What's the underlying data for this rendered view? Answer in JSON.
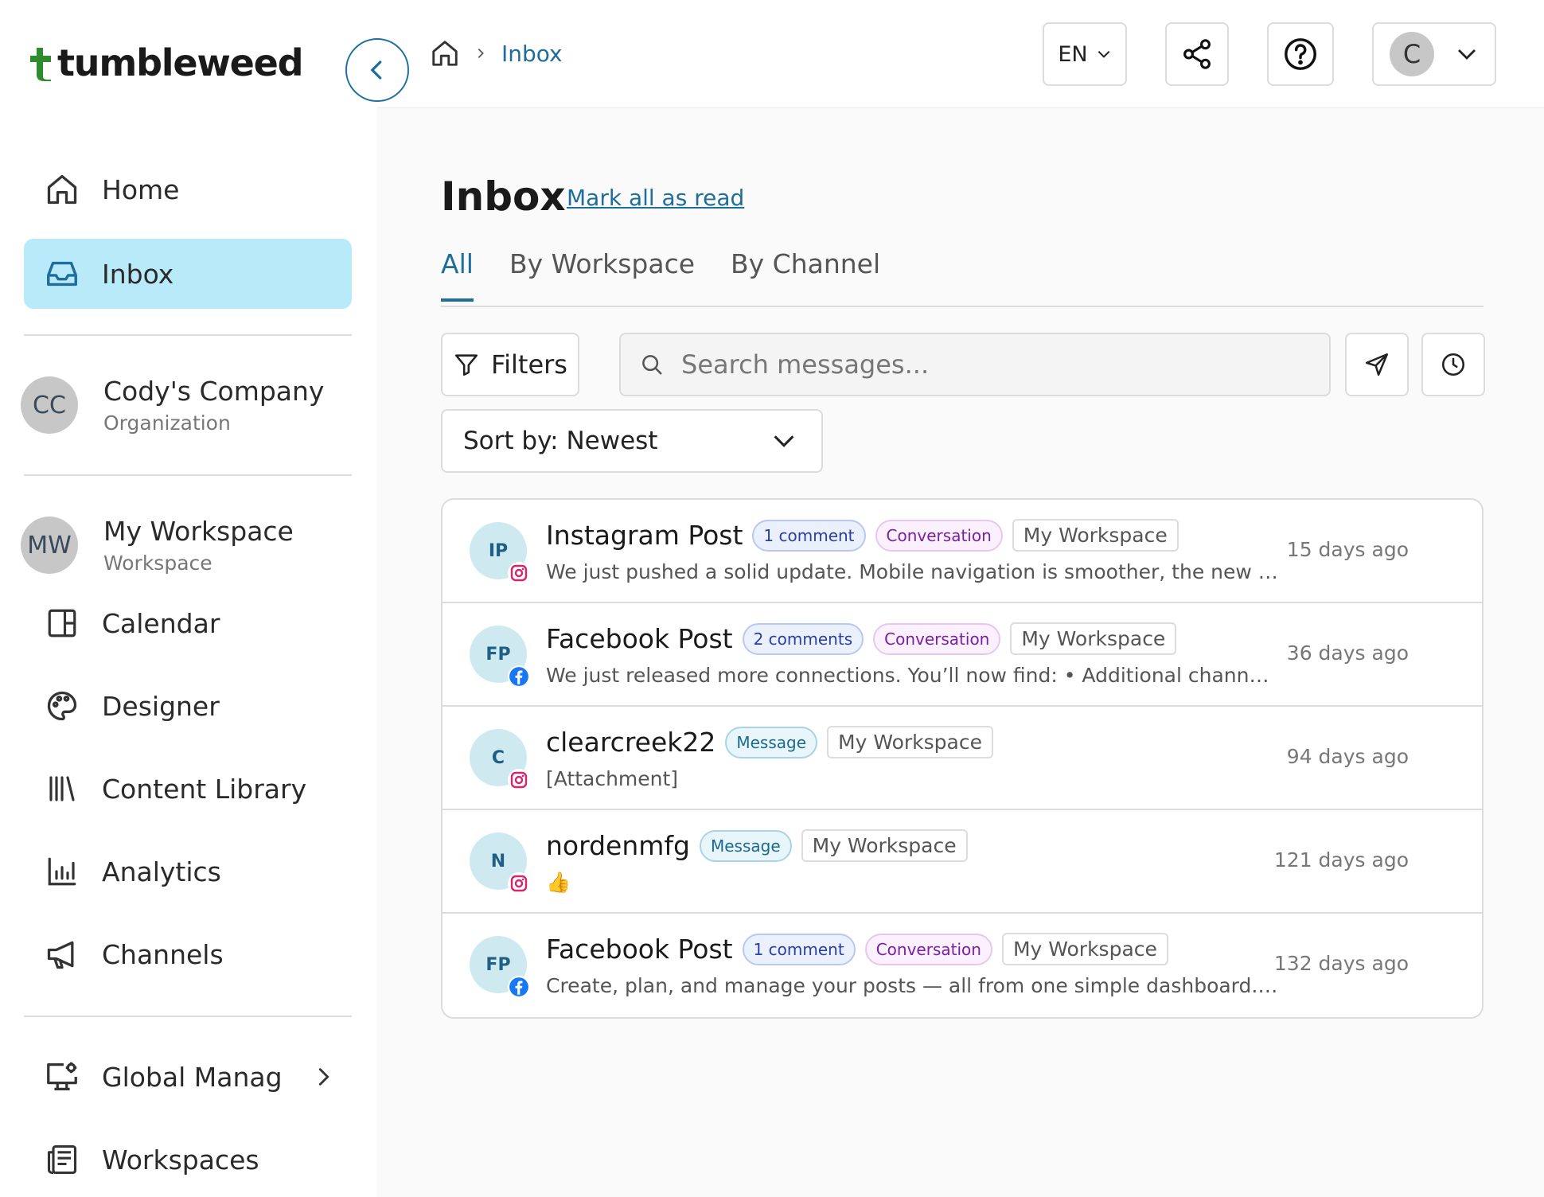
{
  "app": {
    "brand": "tumbleweed",
    "brand_color": "#2e8b2e",
    "accent": "#1f6e9a"
  },
  "sidebar": {
    "primary": [
      {
        "label": "Home",
        "icon": "home-icon"
      },
      {
        "label": "Inbox",
        "icon": "inbox-icon",
        "active": true
      }
    ],
    "organization": {
      "initials": "CC",
      "name": "Cody's Company",
      "type": "Organization"
    },
    "workspace": {
      "initials": "MW",
      "name": "My Workspace",
      "type": "Workspace"
    },
    "workspace_items": [
      {
        "label": "Calendar",
        "icon": "calendar-icon"
      },
      {
        "label": "Designer",
        "icon": "palette-icon"
      },
      {
        "label": "Content Library",
        "icon": "library-icon"
      },
      {
        "label": "Analytics",
        "icon": "analytics-icon"
      },
      {
        "label": "Channels",
        "icon": "megaphone-icon"
      }
    ],
    "bottom_items": [
      {
        "label": "Global Manag",
        "icon": "monitor-gear-icon",
        "has_chevron": true
      },
      {
        "label": "Workspaces",
        "icon": "workspaces-icon"
      }
    ]
  },
  "topbar": {
    "breadcrumb": {
      "current": "Inbox"
    },
    "language": "EN",
    "user_initial": "C"
  },
  "main": {
    "title": "Inbox",
    "mark_all_read": "Mark all as read",
    "tabs": [
      {
        "label": "All",
        "active": true
      },
      {
        "label": "By Workspace"
      },
      {
        "label": "By Channel"
      }
    ],
    "filters_label": "Filters",
    "search_placeholder": "Search messages...",
    "sort_label": "Sort by: Newest",
    "messages": [
      {
        "initials": "IP",
        "platform": "instagram",
        "title": "Instagram Post",
        "count": "1 comment",
        "type": "Conversation",
        "workspace": "My Workspace",
        "preview": "We just pushed a solid update. Mobile navigation is smoother, the new Wor...",
        "time": "15 days ago"
      },
      {
        "initials": "FP",
        "platform": "facebook",
        "title": "Facebook Post",
        "count": "2 comments",
        "type": "Conversation",
        "workspace": "My Workspace",
        "preview": "We just released more connections. You’ll now find: • Additional channel su...",
        "time": "36 days ago"
      },
      {
        "initials": "C",
        "platform": "instagram",
        "title": "clearcreek22",
        "type": "Message",
        "workspace": "My Workspace",
        "preview": "[Attachment]",
        "time": "94 days ago"
      },
      {
        "initials": "N",
        "platform": "instagram",
        "title": "nordenmfg",
        "type": "Message",
        "workspace": "My Workspace",
        "preview": "👍",
        "time": "121 days ago"
      },
      {
        "initials": "FP",
        "platform": "facebook",
        "title": "Facebook Post",
        "count": "1 comment",
        "type": "Conversation",
        "workspace": "My Workspace",
        "preview": "Create, plan, and manage your posts — all from one simple dashboard. Tu...",
        "time": "132 days ago"
      }
    ]
  }
}
